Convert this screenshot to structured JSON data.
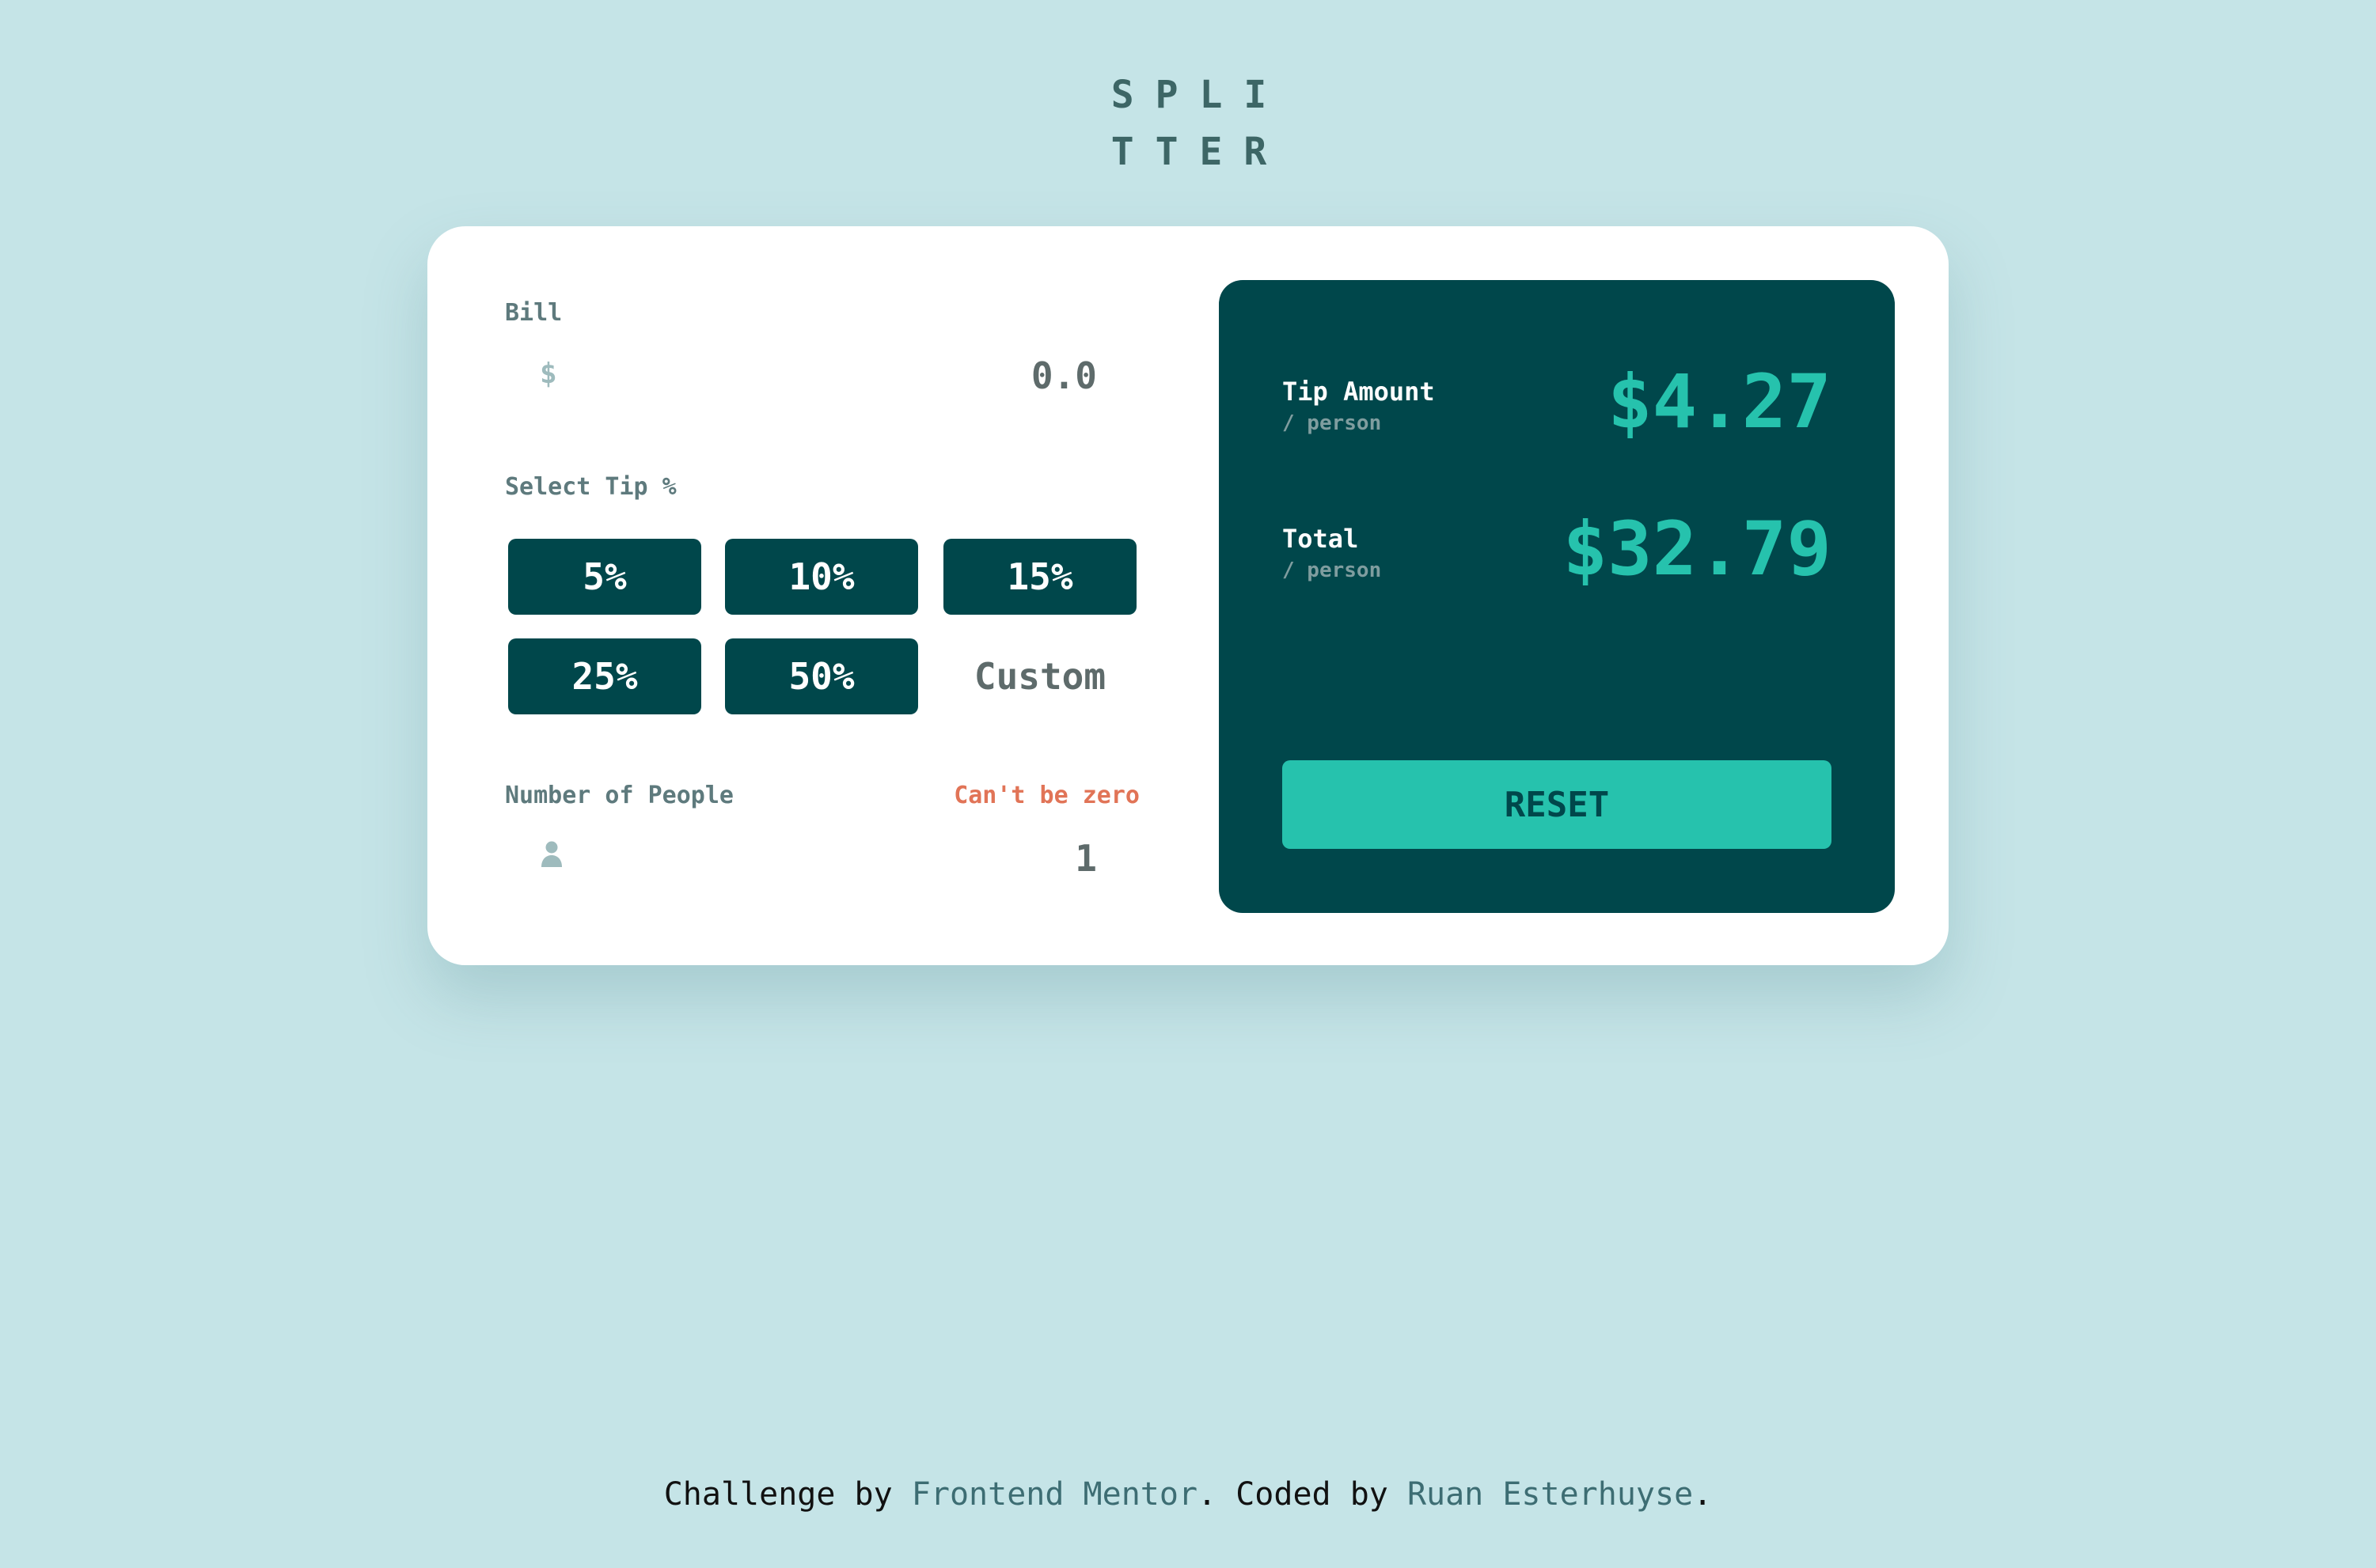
{
  "logo": {
    "line1": "SPLI",
    "line2": "TTER"
  },
  "form": {
    "bill_label": "Bill",
    "bill_icon": "$",
    "bill_value": "0.0",
    "tip_label": "Select Tip %",
    "tips": [
      {
        "label": "5%"
      },
      {
        "label": "10%"
      },
      {
        "label": "15%"
      },
      {
        "label": "25%"
      },
      {
        "label": "50%"
      }
    ],
    "custom_placeholder": "Custom",
    "people_label": "Number of People",
    "people_error": "Can't be zero",
    "people_icon": "person-icon",
    "people_value": "1"
  },
  "results": {
    "tip_title": "Tip Amount",
    "tip_sub": "/ person",
    "tip_value": "$4.27",
    "total_title": "Total",
    "total_sub": "/ person",
    "total_value": "$32.79",
    "reset_label": "RESET"
  },
  "footer": {
    "prefix": "Challenge by ",
    "link1": "Frontend Mentor",
    "middle": ". Coded by ",
    "link2": "Ruan Esterhuyse",
    "suffix": "."
  },
  "colors": {
    "background": "#c5e4e7",
    "dark_cyan": "#00474b",
    "strong_cyan": "#26c2ad",
    "error": "#e17457"
  }
}
